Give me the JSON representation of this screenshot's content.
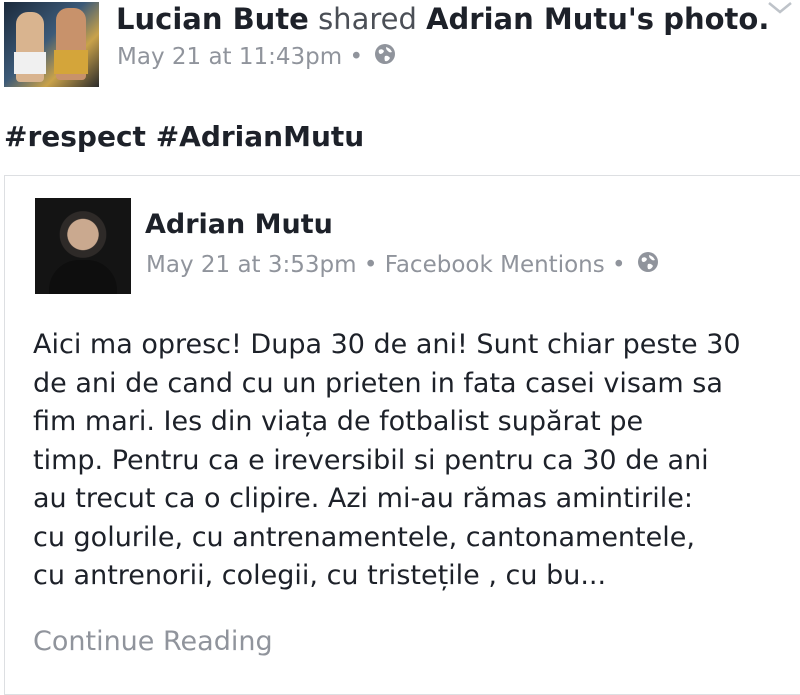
{
  "header": {
    "actor": "Lucian Bute",
    "verb": "shared",
    "owner": "Adrian Mutu's",
    "object": "photo.",
    "timestamp": "May 21 at 11:43pm",
    "separator": "•",
    "privacy_icon": "globe-icon",
    "menu_icon": "chevron-down-icon"
  },
  "status": {
    "text": "#respect #AdrianMutu"
  },
  "shared_post": {
    "author": "Adrian Mutu",
    "timestamp": "May 21 at 3:53pm",
    "separator": "•",
    "source": "Facebook Mentions",
    "separator2": "•",
    "privacy_icon": "globe-icon",
    "lines": [
      "Aici ma opresc! Dupa 30 de ani! Sunt chiar peste 30",
      "de ani de cand cu un prieten in fata casei visam sa",
      "fim mari. Ies din viața de fotbalist supărat pe",
      "timp. Pentru ca e ireversibil si pentru ca 30 de ani",
      "au trecut ca o clipire. Azi mi-au rămas amintirile:",
      "cu golurile, cu antrenamentele, cantonamentele,",
      "cu antrenorii, colegii, cu tristețile , cu bu..."
    ],
    "continue_label": "Continue Reading"
  },
  "colors": {
    "text": "#1d2129",
    "meta": "#90949c",
    "border": "#dddfe2"
  }
}
